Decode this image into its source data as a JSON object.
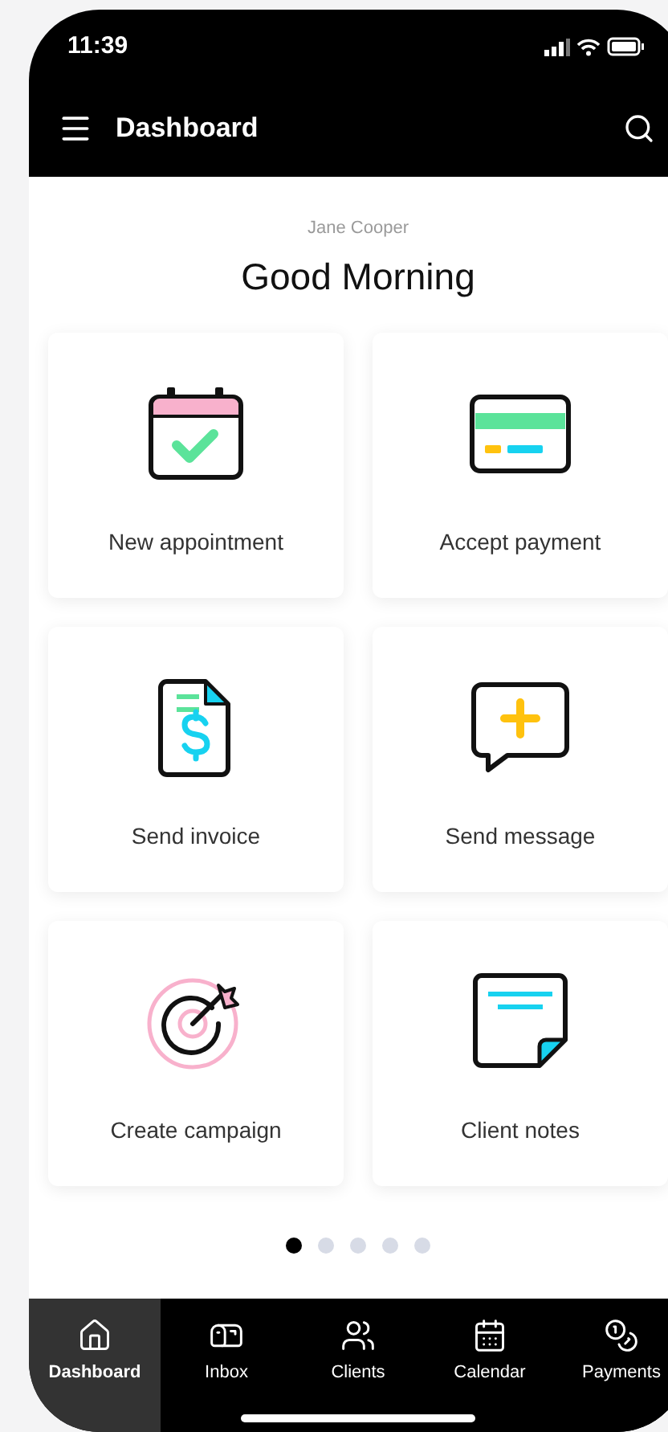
{
  "status_bar": {
    "time": "11:39"
  },
  "header": {
    "title": "Dashboard"
  },
  "greeting": {
    "name": "Jane Cooper",
    "title": "Good Morning"
  },
  "actions": [
    {
      "kind": "appointment",
      "label": "New appointment"
    },
    {
      "kind": "payment",
      "label": "Accept payment"
    },
    {
      "kind": "invoice",
      "label": "Send invoice"
    },
    {
      "kind": "message",
      "label": "Send message"
    },
    {
      "kind": "campaign",
      "label": "Create campaign"
    },
    {
      "kind": "notes",
      "label": "Client notes"
    }
  ],
  "pager": [
    {
      "selected": true
    },
    {
      "selected": false
    },
    {
      "selected": false
    },
    {
      "selected": false
    },
    {
      "selected": false
    }
  ],
  "tab_bar": [
    {
      "kind": "home",
      "label": "Dashboard",
      "selected": true
    },
    {
      "kind": "mailbox",
      "label": "Inbox",
      "selected": false
    },
    {
      "kind": "users",
      "label": "Clients",
      "selected": false
    },
    {
      "kind": "calendar",
      "label": "Calendar",
      "selected": false
    },
    {
      "kind": "coins",
      "label": "Payments",
      "selected": false
    }
  ]
}
